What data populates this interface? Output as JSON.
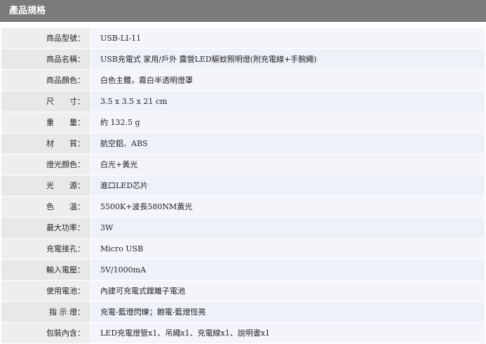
{
  "header": {
    "title": "產品規格"
  },
  "specs": [
    {
      "label": "商品型號：",
      "value": "USB-LI-11"
    },
    {
      "label": "商品名稱：",
      "value": "USB充電式 家用/戶外 露營LED驅蚊照明燈(附充電線+手腕繩)"
    },
    {
      "label": "商品顏色：",
      "value": "白色主體，霧白半透明燈罩"
    },
    {
      "label": "尺　　寸：",
      "value": "3.5 x 3.5 x 21 cm"
    },
    {
      "label": "重　　量：",
      "value": "約 132.5 g"
    },
    {
      "label": "材　　質：",
      "value": "航空鋁、ABS"
    },
    {
      "label": "燈光顏色：",
      "value": "白光+黃光"
    },
    {
      "label": "光　　源：",
      "value": "進口LED芯片"
    },
    {
      "label": "色　　溫：",
      "value": "5500K+波長580NM黃光"
    },
    {
      "label": "最大功率：",
      "value": "3W"
    },
    {
      "label": "充電接孔：",
      "value": "Micro USB"
    },
    {
      "label": "輸入電壓：",
      "value": "5V/1000mA"
    },
    {
      "label": "使用電池：",
      "value": "內建可充電式鋰離子電池"
    },
    {
      "label": "指 示 燈：",
      "value": "充電-藍燈閃爍；飽電-藍燈恆亮"
    },
    {
      "label": "包裝內含：",
      "value": "LED充電燈管x1、吊繩x1、充電線x1、說明書x1"
    }
  ]
}
